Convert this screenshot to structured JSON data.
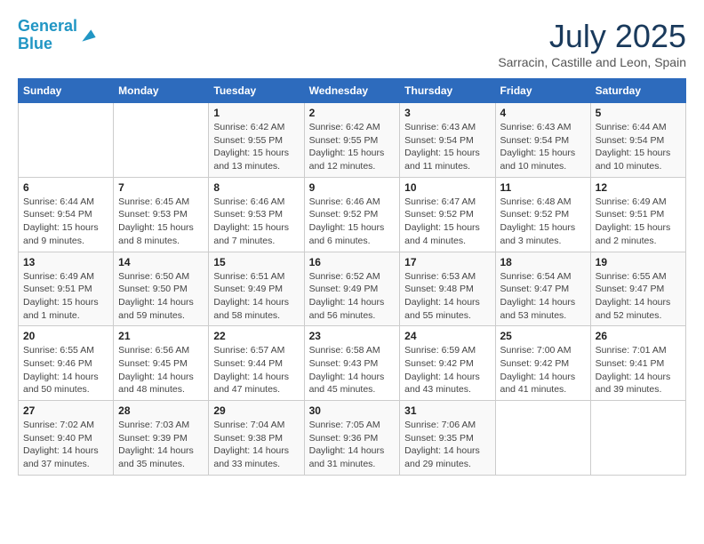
{
  "logo": {
    "line1": "General",
    "line2": "Blue"
  },
  "title": "July 2025",
  "subtitle": "Sarracin, Castille and Leon, Spain",
  "headers": [
    "Sunday",
    "Monday",
    "Tuesday",
    "Wednesday",
    "Thursday",
    "Friday",
    "Saturday"
  ],
  "weeks": [
    [
      {
        "day": "",
        "info": ""
      },
      {
        "day": "",
        "info": ""
      },
      {
        "day": "1",
        "info": "Sunrise: 6:42 AM\nSunset: 9:55 PM\nDaylight: 15 hours and 13 minutes."
      },
      {
        "day": "2",
        "info": "Sunrise: 6:42 AM\nSunset: 9:55 PM\nDaylight: 15 hours and 12 minutes."
      },
      {
        "day": "3",
        "info": "Sunrise: 6:43 AM\nSunset: 9:54 PM\nDaylight: 15 hours and 11 minutes."
      },
      {
        "day": "4",
        "info": "Sunrise: 6:43 AM\nSunset: 9:54 PM\nDaylight: 15 hours and 10 minutes."
      },
      {
        "day": "5",
        "info": "Sunrise: 6:44 AM\nSunset: 9:54 PM\nDaylight: 15 hours and 10 minutes."
      }
    ],
    [
      {
        "day": "6",
        "info": "Sunrise: 6:44 AM\nSunset: 9:54 PM\nDaylight: 15 hours and 9 minutes."
      },
      {
        "day": "7",
        "info": "Sunrise: 6:45 AM\nSunset: 9:53 PM\nDaylight: 15 hours and 8 minutes."
      },
      {
        "day": "8",
        "info": "Sunrise: 6:46 AM\nSunset: 9:53 PM\nDaylight: 15 hours and 7 minutes."
      },
      {
        "day": "9",
        "info": "Sunrise: 6:46 AM\nSunset: 9:52 PM\nDaylight: 15 hours and 6 minutes."
      },
      {
        "day": "10",
        "info": "Sunrise: 6:47 AM\nSunset: 9:52 PM\nDaylight: 15 hours and 4 minutes."
      },
      {
        "day": "11",
        "info": "Sunrise: 6:48 AM\nSunset: 9:52 PM\nDaylight: 15 hours and 3 minutes."
      },
      {
        "day": "12",
        "info": "Sunrise: 6:49 AM\nSunset: 9:51 PM\nDaylight: 15 hours and 2 minutes."
      }
    ],
    [
      {
        "day": "13",
        "info": "Sunrise: 6:49 AM\nSunset: 9:51 PM\nDaylight: 15 hours and 1 minute."
      },
      {
        "day": "14",
        "info": "Sunrise: 6:50 AM\nSunset: 9:50 PM\nDaylight: 14 hours and 59 minutes."
      },
      {
        "day": "15",
        "info": "Sunrise: 6:51 AM\nSunset: 9:49 PM\nDaylight: 14 hours and 58 minutes."
      },
      {
        "day": "16",
        "info": "Sunrise: 6:52 AM\nSunset: 9:49 PM\nDaylight: 14 hours and 56 minutes."
      },
      {
        "day": "17",
        "info": "Sunrise: 6:53 AM\nSunset: 9:48 PM\nDaylight: 14 hours and 55 minutes."
      },
      {
        "day": "18",
        "info": "Sunrise: 6:54 AM\nSunset: 9:47 PM\nDaylight: 14 hours and 53 minutes."
      },
      {
        "day": "19",
        "info": "Sunrise: 6:55 AM\nSunset: 9:47 PM\nDaylight: 14 hours and 52 minutes."
      }
    ],
    [
      {
        "day": "20",
        "info": "Sunrise: 6:55 AM\nSunset: 9:46 PM\nDaylight: 14 hours and 50 minutes."
      },
      {
        "day": "21",
        "info": "Sunrise: 6:56 AM\nSunset: 9:45 PM\nDaylight: 14 hours and 48 minutes."
      },
      {
        "day": "22",
        "info": "Sunrise: 6:57 AM\nSunset: 9:44 PM\nDaylight: 14 hours and 47 minutes."
      },
      {
        "day": "23",
        "info": "Sunrise: 6:58 AM\nSunset: 9:43 PM\nDaylight: 14 hours and 45 minutes."
      },
      {
        "day": "24",
        "info": "Sunrise: 6:59 AM\nSunset: 9:42 PM\nDaylight: 14 hours and 43 minutes."
      },
      {
        "day": "25",
        "info": "Sunrise: 7:00 AM\nSunset: 9:42 PM\nDaylight: 14 hours and 41 minutes."
      },
      {
        "day": "26",
        "info": "Sunrise: 7:01 AM\nSunset: 9:41 PM\nDaylight: 14 hours and 39 minutes."
      }
    ],
    [
      {
        "day": "27",
        "info": "Sunrise: 7:02 AM\nSunset: 9:40 PM\nDaylight: 14 hours and 37 minutes."
      },
      {
        "day": "28",
        "info": "Sunrise: 7:03 AM\nSunset: 9:39 PM\nDaylight: 14 hours and 35 minutes."
      },
      {
        "day": "29",
        "info": "Sunrise: 7:04 AM\nSunset: 9:38 PM\nDaylight: 14 hours and 33 minutes."
      },
      {
        "day": "30",
        "info": "Sunrise: 7:05 AM\nSunset: 9:36 PM\nDaylight: 14 hours and 31 minutes."
      },
      {
        "day": "31",
        "info": "Sunrise: 7:06 AM\nSunset: 9:35 PM\nDaylight: 14 hours and 29 minutes."
      },
      {
        "day": "",
        "info": ""
      },
      {
        "day": "",
        "info": ""
      }
    ]
  ]
}
